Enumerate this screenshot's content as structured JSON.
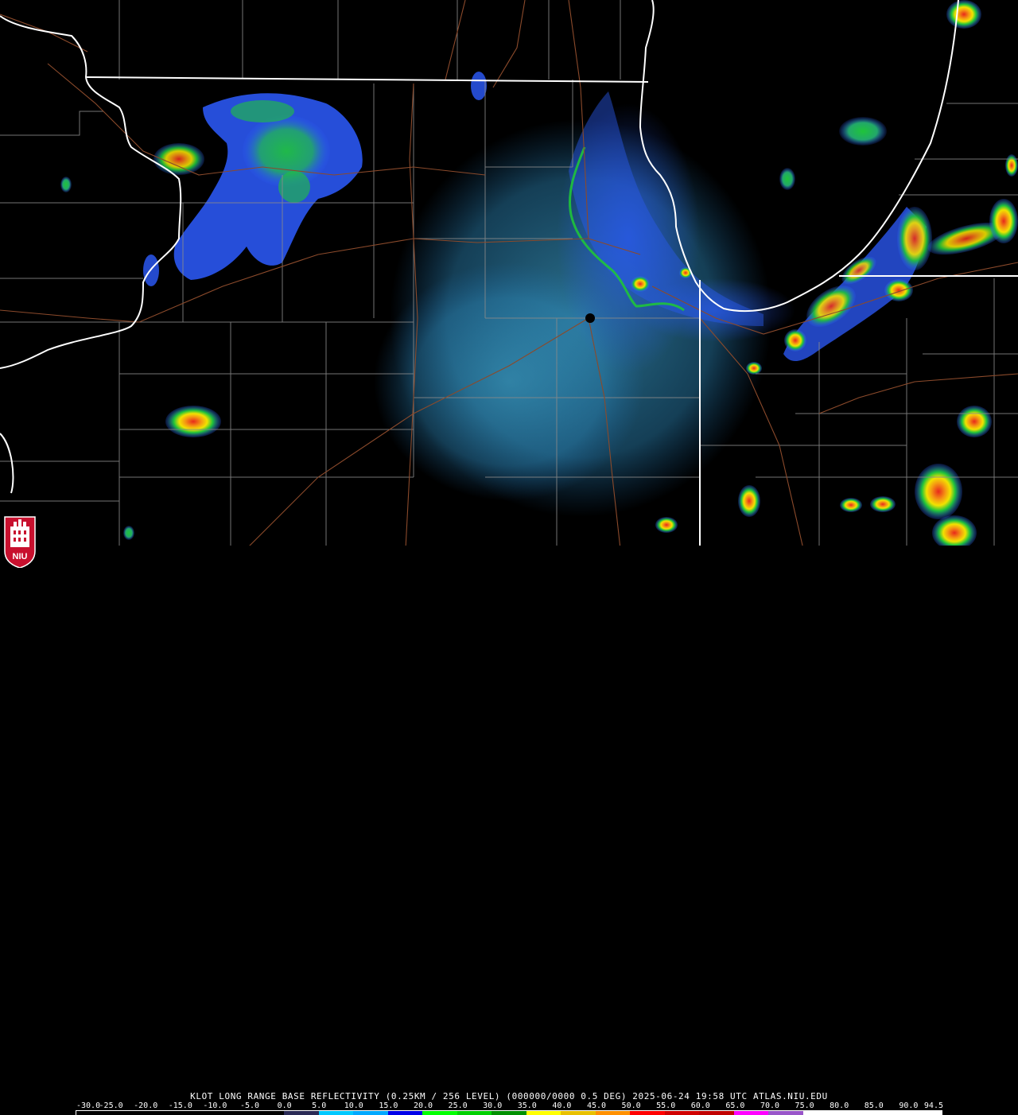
{
  "caption": "KLOT LONG RANGE BASE REFLECTIVITY (0.25KM / 256 LEVEL) (000000/0000 0.5 DEG) 2025-06-24 19:58 UTC  ATLAS.NIU.EDU",
  "radar_site": "KLOT",
  "product": "LONG RANGE BASE REFLECTIVITY",
  "valid_time": "2025-06-24 19:58 UTC",
  "source": "ATLAS.NIU.EDU",
  "scale_labels": [
    "-30.0",
    "-25.0",
    "-20.0",
    "-15.0",
    "-10.0",
    "-5.0",
    "0.0",
    "5.0",
    "10.0",
    "15.0",
    "20.0",
    "25.0",
    "30.0",
    "35.0",
    "40.0",
    "45.0",
    "50.0",
    "55.0",
    "60.0",
    "65.0",
    "70.0",
    "75.0",
    "80.0",
    "85.0",
    "90.0",
    "94.5"
  ],
  "colorbar_colors": [
    "#000000",
    "#000000",
    "#000000",
    "#000000",
    "#000000",
    "#000000",
    "#2a2a55",
    "#00c8ff",
    "#00a8ff",
    "#0000e8",
    "#00ff00",
    "#00d000",
    "#009000",
    "#ffff00",
    "#e8c000",
    "#ff9000",
    "#ff0000",
    "#d00000",
    "#c00000",
    "#ff00ff",
    "#9955c9",
    "#ffffff",
    "#ffffff",
    "#ffffff",
    "#ffffff"
  ],
  "logo_text": "NIU",
  "map_colors": {
    "state_lines": "#ffffff",
    "county_lines": "#8a8a8a",
    "highways": "#8b4a2b",
    "light_echo": "#4fb8d8",
    "moderate_echo": "#2d5cff",
    "green_echo": "#1fc43a",
    "yellow_echo": "#f2e200",
    "red_echo": "#e8281c"
  }
}
